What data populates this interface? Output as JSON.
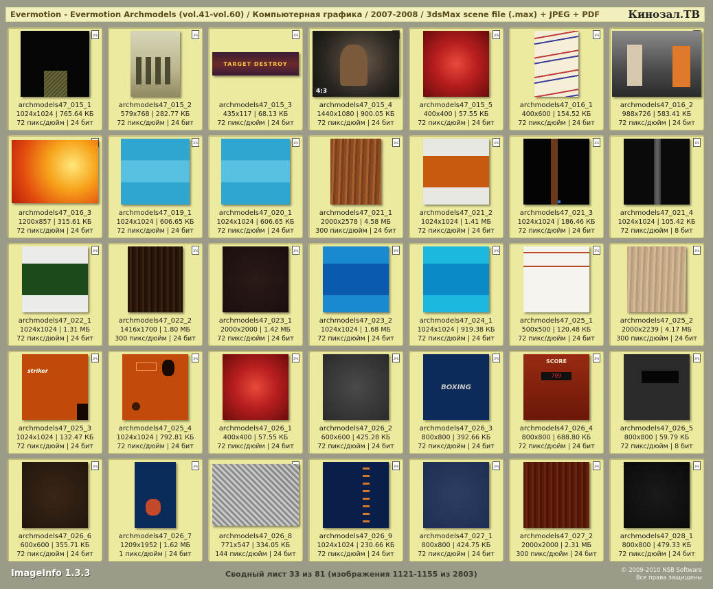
{
  "window": {
    "title": "Evermotion - Evermotion Archmodels (vol.41-vol.60) / Компьютерная графика / 2007-2008 / 3dsMax scene file (.max) + JPEG + PDF",
    "brand": "Кинозал.ТВ"
  },
  "file_badge": "JPG",
  "tiles": [
    {
      "name": "archmodels47_015_1",
      "dims": "1024x1024 | 765.64 КБ",
      "info": "72 пикс/дюйм | 24 бит",
      "icon": "dark-texture-thumbnail"
    },
    {
      "name": "archmodels47_015_2",
      "dims": "579x768 | 282.77 КБ",
      "info": "72 пикс/дюйм | 24 бит",
      "icon": "soldiers-thumbnail"
    },
    {
      "name": "archmodels47_015_3",
      "dims": "435x117 | 68.13 КБ",
      "info": "72 пикс/дюйм | 24 бит",
      "icon": "target-destroy-thumbnail",
      "label": "TARGET DESTROY"
    },
    {
      "name": "archmodels47_015_4",
      "dims": "1440x1080 | 900.05 КБ",
      "info": "72 пикс/дюйм | 24 бит",
      "icon": "game-scene-thumbnail",
      "aspect": "4:3"
    },
    {
      "name": "archmodels47_015_5",
      "dims": "400x400 | 57.55 КБ",
      "info": "72 пикс/дюйм | 24 бит",
      "icon": "red-glow-thumbnail"
    },
    {
      "name": "archmodels47_016_1",
      "dims": "400x600 | 154.52 КБ",
      "info": "72 пикс/дюйм | 24 бит",
      "icon": "wave-pattern-thumbnail"
    },
    {
      "name": "archmodels47_016_2",
      "dims": "988x726 | 583.41 КБ",
      "info": "72 пикс/дюйм | 24 бит",
      "icon": "fighters-thumbnail"
    },
    {
      "name": "archmodels47_016_3",
      "dims": "1200x857 | 315.61 КБ",
      "info": "72 пикс/дюйм | 24 бит",
      "icon": "fire-thumbnail"
    },
    {
      "name": "archmodels47_019_1",
      "dims": "1024x1024 | 606.65 КБ",
      "info": "72 пикс/дюйм | 24 бит",
      "icon": "blue-stripes-thumbnail"
    },
    {
      "name": "archmodels47_020_1",
      "dims": "1024x1024 | 606.65 КБ",
      "info": "72 пикс/дюйм | 24 бит",
      "icon": "blue-stripes-thumbnail"
    },
    {
      "name": "archmodels47_021_1",
      "dims": "2000x2578 | 4.58 МБ",
      "info": "300 пикс/дюйм | 24 бит",
      "icon": "wood-thumbnail"
    },
    {
      "name": "archmodels47_021_2",
      "dims": "1024x1024 | 1.41 МБ",
      "info": "72 пикс/дюйм | 24 бит",
      "icon": "orange-band-thumbnail"
    },
    {
      "name": "archmodels47_021_3",
      "dims": "1024x1024 | 186.46 КБ",
      "info": "72 пикс/дюйм | 24 бит",
      "icon": "black-wood-strip-thumbnail"
    },
    {
      "name": "archmodels47_021_4",
      "dims": "1024x1024 | 105.42 КБ",
      "info": "72 пикс/дюйм | 8 бит",
      "icon": "black-gray-strip-thumbnail"
    },
    {
      "name": "archmodels47_022_1",
      "dims": "1024x1024 | 1.31 МБ",
      "info": "72 пикс/дюйм | 24 бит",
      "icon": "green-band-thumbnail"
    },
    {
      "name": "archmodels47_022_2",
      "dims": "1416x1700 | 1.80 МБ",
      "info": "300 пикс/дюйм | 24 бит",
      "icon": "dark-wood-thumbnail"
    },
    {
      "name": "archmodels47_023_1",
      "dims": "2000x2000 | 1.42 МБ",
      "info": "72 пикс/дюйм | 24 бит",
      "icon": "dark-leather-thumbnail"
    },
    {
      "name": "archmodels47_023_2",
      "dims": "1024x1024 | 1.68 МБ",
      "info": "72 пикс/дюйм | 24 бит",
      "icon": "blue-band-thumbnail"
    },
    {
      "name": "archmodels47_024_1",
      "dims": "1024x1024 | 919.38 КБ",
      "info": "72 пикс/дюйм | 24 бит",
      "icon": "cyan-band-thumbnail"
    },
    {
      "name": "archmodels47_025_1",
      "dims": "500x500 | 120.48 КБ",
      "info": "72 пикс/дюйм | 24 бит",
      "icon": "white-lines-thumbnail"
    },
    {
      "name": "archmodels47_025_2",
      "dims": "2000x2239 | 4.17 МБ",
      "info": "300 пикс/дюйм | 24 бит",
      "icon": "beige-wood-thumbnail"
    },
    {
      "name": "archmodels47_025_3",
      "dims": "1024x1024 | 132.47 КБ",
      "info": "72 пикс/дюйм | 24 бит",
      "icon": "striker-thumbnail",
      "label": "striker"
    },
    {
      "name": "archmodels47_025_4",
      "dims": "1024x1024 | 792.81 КБ",
      "info": "72 пикс/дюйм | 24 бит",
      "icon": "orange-splatter-thumbnail"
    },
    {
      "name": "archmodels47_026_1",
      "dims": "400x400 | 57.55 КБ",
      "info": "72 пикс/дюйм | 24 бит",
      "icon": "red-glow-thumbnail"
    },
    {
      "name": "archmodels47_026_2",
      "dims": "600x600 | 425.28 КБ",
      "info": "72 пикс/дюйм | 24 бит",
      "icon": "dark-stone-thumbnail"
    },
    {
      "name": "archmodels47_026_3",
      "dims": "800x800 | 392.66 КБ",
      "info": "72 пикс/дюйм | 24 бит",
      "icon": "boxing-thumbnail",
      "label": "BOXING"
    },
    {
      "name": "archmodels47_026_4",
      "dims": "800x800 | 688.80 КБ",
      "info": "72 пикс/дюйм | 24 бит",
      "icon": "score-thumbnail",
      "label": "SCORE",
      "sublabel": "709"
    },
    {
      "name": "archmodels47_026_5",
      "dims": "800x800 | 59.79 КБ",
      "info": "72 пикс/дюйм | 8 бит",
      "icon": "dark-panel-thumbnail"
    },
    {
      "name": "archmodels47_026_6",
      "dims": "600x600 | 355.71 КБ",
      "info": "72 пикс/дюйм | 24 бит",
      "icon": "dark-brown-thumbnail"
    },
    {
      "name": "archmodels47_026_7",
      "dims": "1209x1952 | 1.62 МБ",
      "info": "1 пикс/дюйм | 24 бит",
      "icon": "boxer-poster-thumbnail"
    },
    {
      "name": "archmodels47_026_8",
      "dims": "771x547 | 334.05 КБ",
      "info": "144 пикс/дюйм | 24 бит",
      "icon": "diamond-plate-thumbnail"
    },
    {
      "name": "archmodels47_026_9",
      "dims": "1024x1024 | 230.66 КБ",
      "info": "72 пикс/дюйм | 24 бит",
      "icon": "blue-dots-thumbnail"
    },
    {
      "name": "archmodels47_027_1",
      "dims": "800x800 | 424.75 КБ",
      "info": "72 пикс/дюйм | 24 бит",
      "icon": "navy-fabric-thumbnail"
    },
    {
      "name": "archmodels47_027_2",
      "dims": "2000x2000 | 2.31 МБ",
      "info": "300 пикс/дюйм | 24 бит",
      "icon": "mahogany-thumbnail"
    },
    {
      "name": "archmodels47_028_1",
      "dims": "800x800 | 479.33 КБ",
      "info": "72 пикс/дюйм | 24 бит",
      "icon": "black-texture-thumbnail"
    }
  ],
  "footer": {
    "app": "ImageInfo 1.3.3",
    "status": "Сводный лист 33 из 81 (изображения 1121-1155 из 2803)",
    "copyright": "© 2009-2010 NSB Software",
    "rights": "Все права защищены"
  }
}
